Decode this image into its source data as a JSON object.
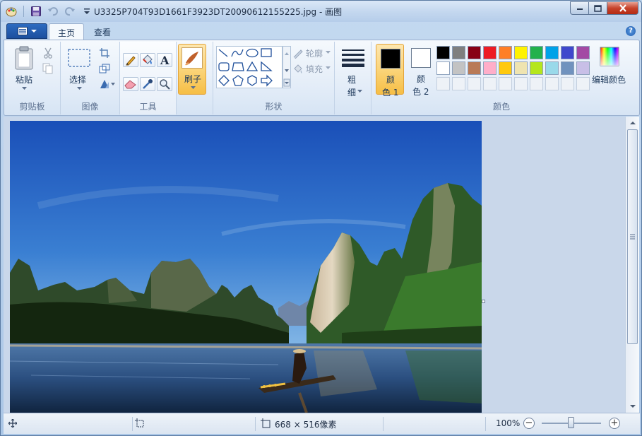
{
  "window": {
    "title": "U3325P704T93D1661F3923DT20090612155225.jpg - 画图"
  },
  "tabs": {
    "home": "主页",
    "view": "查看"
  },
  "clipboard": {
    "paste": "粘贴",
    "group": "剪贴板"
  },
  "image_group": {
    "select": "选择",
    "group": "图像"
  },
  "tools": {
    "group": "工具"
  },
  "brushes": {
    "label": "刷子"
  },
  "shapes": {
    "outline": "轮廓",
    "fill": "填充",
    "group": "形状"
  },
  "size": {
    "line1": "粗",
    "line2": "细"
  },
  "colors": {
    "color1_line1": "颜",
    "color1_line2": "色 1",
    "color2_line1": "颜",
    "color2_line2": "色 2",
    "edit": "编辑颜色",
    "group": "颜色",
    "color1_value": "#000000",
    "color2_value": "#ffffff",
    "palette_row1": [
      "#000000",
      "#7f7f7f",
      "#880015",
      "#ed1c24",
      "#ff7f27",
      "#fff200",
      "#22b14c",
      "#00a2e8",
      "#3f48cc",
      "#a349a4"
    ],
    "palette_row2": [
      "#ffffff",
      "#c3c3c3",
      "#b97a57",
      "#ffaec9",
      "#ffc90e",
      "#efe4b0",
      "#b5e61d",
      "#99d9ea",
      "#7092be",
      "#c8bfe7"
    ]
  },
  "status": {
    "image_size": "668 × 516像素",
    "zoom": "100%"
  }
}
